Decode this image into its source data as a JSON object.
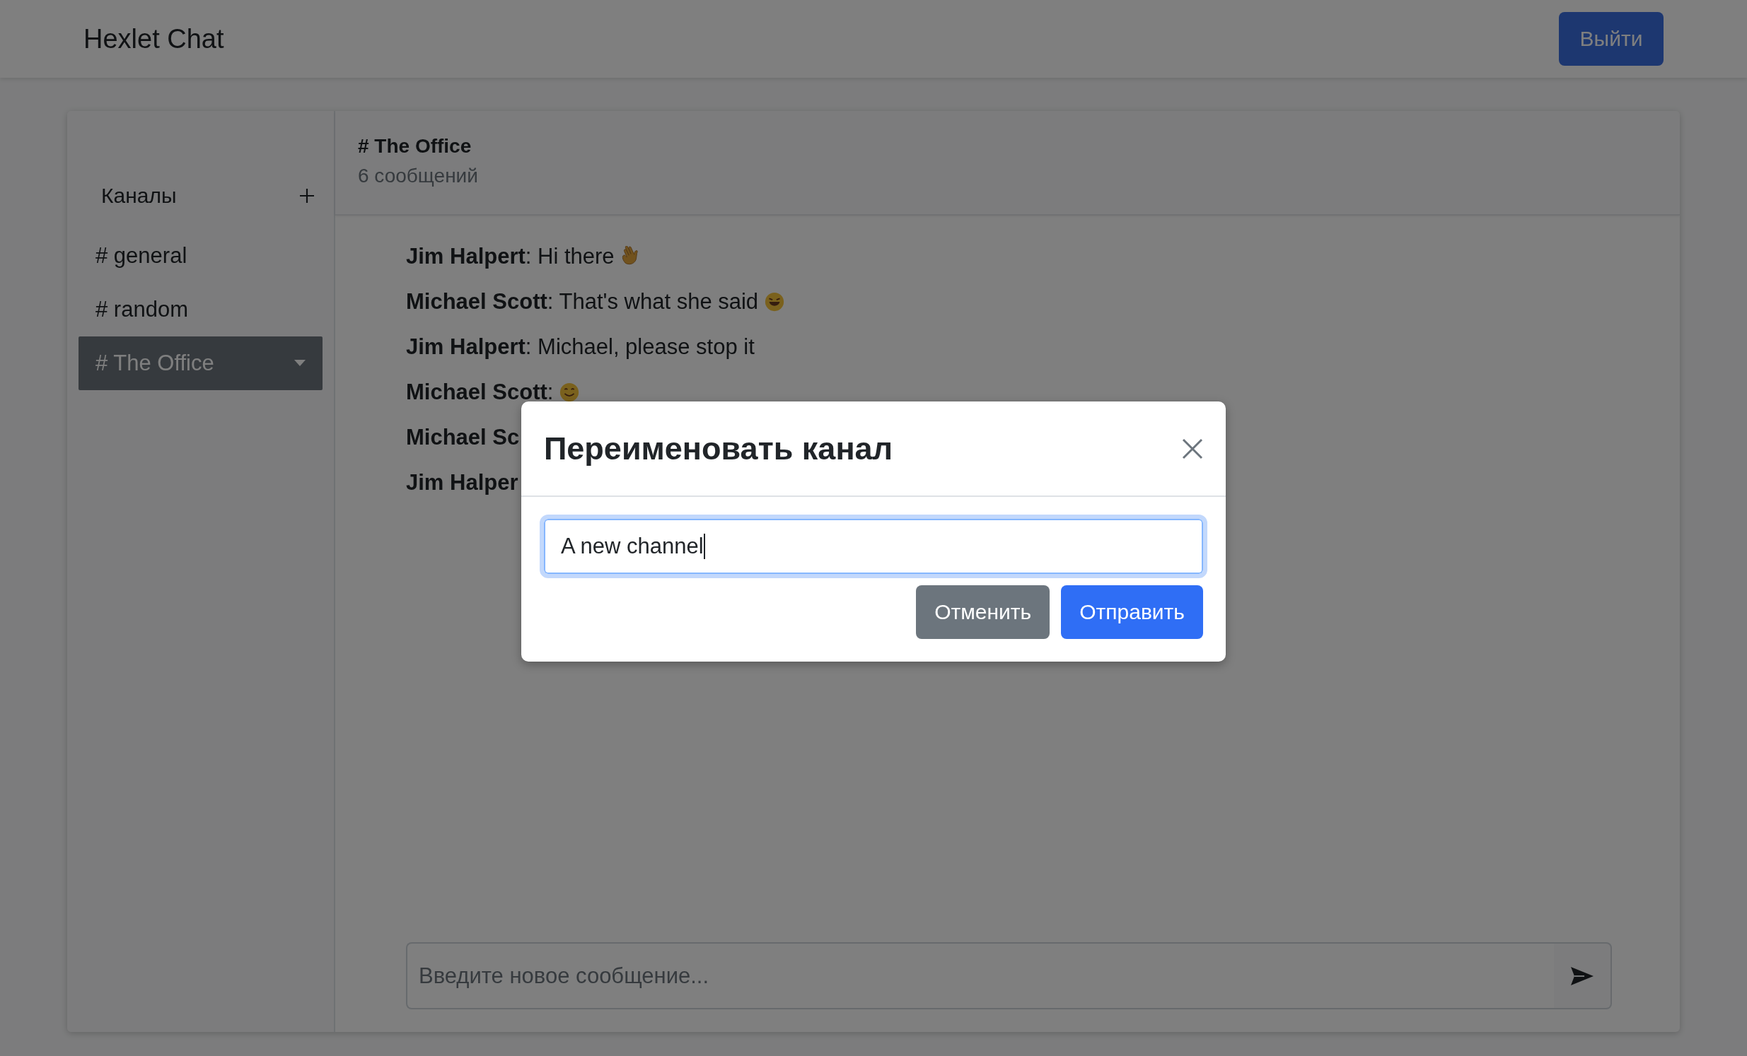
{
  "header": {
    "title": "Hexlet Chat",
    "logout_button": "Выйти"
  },
  "sidebar": {
    "heading": "Каналы",
    "channels": [
      {
        "name": "# general",
        "selected": false,
        "has_menu": false
      },
      {
        "name": "# random",
        "selected": false,
        "has_menu": false
      },
      {
        "name": "# The Office",
        "selected": true,
        "has_menu": true
      }
    ]
  },
  "chat": {
    "title": "# The Office",
    "count": "6 сообщений",
    "messages": [
      {
        "author": "Jim Halpert",
        "text": ": Hi there",
        "kind": "wave"
      },
      {
        "author": "Michael Scott",
        "text": ": That's what she said",
        "kind": "laugh"
      },
      {
        "author": "Jim Halpert",
        "text": ": Michael, please stop it",
        "kind": "plain"
      },
      {
        "author": "Michael Scott",
        "text": ":",
        "kind": "smile"
      },
      {
        "author": "Michael Sc",
        "kind": "plain"
      },
      {
        "author": "Jim Halper",
        "kind": "plain"
      }
    ],
    "composer": {
      "placeholder": "Введите новое сообщение..."
    }
  },
  "modal": {
    "title": "Переименовать канал",
    "value": "A new channel",
    "buttons": [
      {
        "label": "Отменить",
        "kind": "secondary"
      },
      {
        "label": "Отправить",
        "kind": "primary"
      }
    ]
  }
}
